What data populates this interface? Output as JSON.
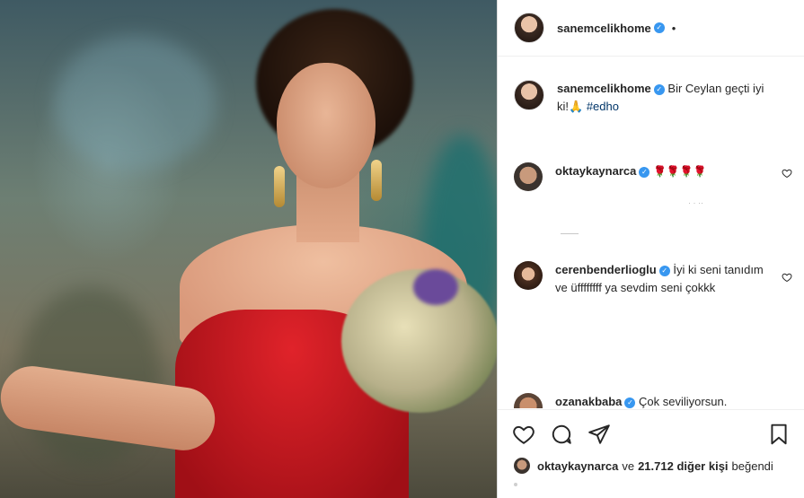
{
  "post": {
    "username": "sanemcelikhome",
    "dot": "•"
  },
  "caption": {
    "username": "sanemcelikhome",
    "text": "Bir Ceylan geçti iyi ki!🙏",
    "hashtag": "#edho"
  },
  "comments": [
    {
      "username": "oktaykaynarca",
      "text": "🌹🌹🌹🌹"
    },
    {
      "username": "cerenbenderlioglu",
      "text": "İyi ki seni tanıdım ve üffffffff ya sevdim seni çokkk"
    },
    {
      "username": "ozanakbaba",
      "text": "Çok seviliyorsun."
    }
  ],
  "likes": {
    "username": "oktaykaynarca",
    "connector": "ve",
    "count_text": "21.712 diğer kişi",
    "suffix": "beğendi"
  },
  "icons": [
    "heart-icon",
    "comment-icon",
    "share-icon",
    "bookmark-icon",
    "verified-icon"
  ],
  "colors": {
    "verified": "#3897f0",
    "hashtag": "#003569",
    "text": "#262626"
  }
}
